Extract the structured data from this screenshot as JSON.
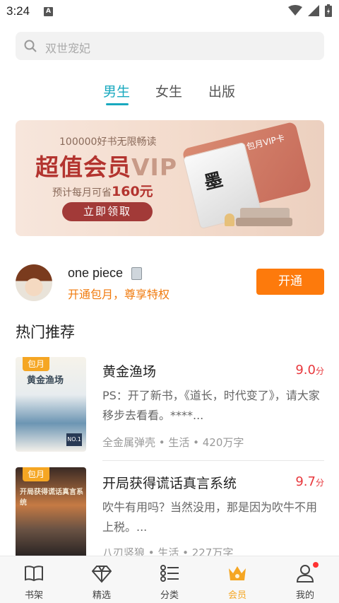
{
  "status": {
    "time": "3:24",
    "notif_letter": "A"
  },
  "search": {
    "placeholder": "双世宠妃"
  },
  "tabs": [
    {
      "label": "男生",
      "active": true
    },
    {
      "label": "女生",
      "active": false
    },
    {
      "label": "出版",
      "active": false
    }
  ],
  "banner": {
    "subtitle": "100000好书无限畅读",
    "title_main": "超值会员",
    "title_vip": "VIP",
    "price_prefix": "预计每月可省",
    "price_value": "160元",
    "button": "立即领取",
    "card_label": "包月VIP卡",
    "card_ink": "墨"
  },
  "member": {
    "username": "one piece",
    "promo": "开通包月，尊享特权",
    "open_button": "开通"
  },
  "section_title": "热门推荐",
  "books": [
    {
      "tag": "包月",
      "cover_text": "黄金渔场",
      "cover_badge": "NO.1",
      "title": "黄金渔场",
      "score": "9.0",
      "score_unit": "分",
      "desc": "PS：开了新书，《道长，时代变了》，请大家移步去看看。****...",
      "meta": "全金属弹壳 • 生活 • 420万字"
    },
    {
      "tag": "包月",
      "cover_text": "开局获得谎话真言系统",
      "title": "开局获得谎话真言系统",
      "score": "9.7",
      "score_unit": "分",
      "desc": "吹牛有用吗？当然没用，那是因为吹牛不用上税。...",
      "meta": "八刃竖狼 • 生活 • 227万字"
    }
  ],
  "nav": [
    {
      "label": "书架",
      "icon": "book-icon"
    },
    {
      "label": "精选",
      "icon": "diamond-icon"
    },
    {
      "label": "分类",
      "icon": "list-icon"
    },
    {
      "label": "会员",
      "icon": "crown-icon",
      "active": true
    },
    {
      "label": "我的",
      "icon": "person-icon"
    }
  ],
  "colors": {
    "accent": "#19a9bf",
    "orange": "#fd7a0c",
    "score": "#e8383d",
    "member": "#f5a623"
  }
}
